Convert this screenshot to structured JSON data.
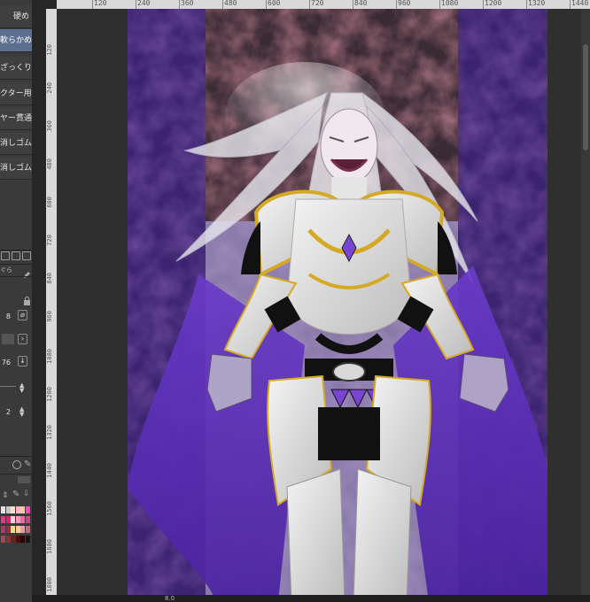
{
  "brush_panel": {
    "items": [
      {
        "label": "硬め",
        "selected": false
      },
      {
        "label": "軟らかめ",
        "selected": true
      },
      {
        "label": "ざっくり",
        "selected": false
      },
      {
        "label": "クター用",
        "selected": false
      },
      {
        "label": "ヤー貫通",
        "selected": false
      },
      {
        "label": "消しゴム",
        "selected": false
      },
      {
        "label": "消しゴム",
        "selected": false
      }
    ]
  },
  "tool_property": {
    "rows": [
      {
        "value": "8",
        "icon": "opacity-icon"
      },
      {
        "value": "",
        "icon": "chevron-right-icon"
      },
      {
        "value": "76",
        "icon": "pressure-icon"
      },
      {
        "value": "",
        "icon": "stepper-icon"
      },
      {
        "value": "2",
        "icon": "stepper-icon"
      }
    ],
    "tab_label": "ぐら"
  },
  "ruler": {
    "horizontal_ticks": [
      "120",
      "240",
      "360",
      "480",
      "600",
      "720",
      "840",
      "960",
      "1080",
      "1200",
      "1320",
      "1440"
    ],
    "vertical_ticks": [
      "120",
      "240",
      "360",
      "480",
      "600",
      "720",
      "840",
      "960",
      "1080",
      "1200",
      "1320",
      "1440",
      "1560",
      "1680",
      "1800"
    ]
  },
  "status": {
    "zoom": "8.0"
  },
  "colors": {
    "panel_bg": "#3a3a3a",
    "selected_item": "#5d6f8f",
    "ruler_bg": "#d9d9d9",
    "workspace_bg": "#2f2f2f",
    "cape_purple": "#5b2fb0",
    "background_purple": "#3d2470",
    "armor_gold": "#c9a21c",
    "armor_silver": "#e2e2e2"
  }
}
